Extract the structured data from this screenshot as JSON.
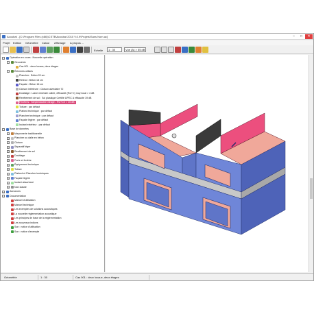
{
  "titlebar": {
    "title": "Acoubat - [C:\\Program Files (x86)\\CSTB\\Acoubat 2010 V.0.9\\Projets\\Sans Nom.ac]",
    "minimize": "–",
    "maximize": "□",
    "close": "✕"
  },
  "menubar": {
    "items": [
      "Projet",
      "Edition",
      "Géométrie",
      "Calcul",
      "Affichage",
      "A propos ..."
    ]
  },
  "toolbar": {
    "scale_label": "Echelle",
    "scale_value": "1 : 30",
    "result_value": "Vue (A) > 55 dB"
  },
  "tree": {
    "rows": [
      {
        "label": "Opération en cours : Nouvelle opération",
        "level": 0,
        "toggle": "-",
        "icon_color": "#3a6fc4"
      },
      {
        "label": "Géométrie",
        "level": 1,
        "toggle": "-",
        "icon_color": "#5a8a3a"
      },
      {
        "label": "Cas 001 : deux locaux, deux étages",
        "level": 2,
        "toggle": "",
        "icon_color": "#e0b040"
      },
      {
        "label": "Éléments utilisés",
        "level": 1,
        "toggle": "-",
        "icon_color": "#5a8a3a"
      },
      {
        "label": "Plancher : Béton 20 cm",
        "level": 2,
        "toggle": "",
        "icon_color": "#c0c0c0"
      },
      {
        "label": "Refend : Béton 18 cm",
        "level": 2,
        "toggle": "",
        "icon_color": "#404040"
      },
      {
        "label": "Façade : Béton 16 cm",
        "level": 2,
        "toggle": "",
        "icon_color": "#5a5acc"
      },
      {
        "label": "Cloison intérieure : Cloison alvéolaire 72",
        "level": 2,
        "toggle": "",
        "icon_color": "#b0b0b0"
      },
      {
        "label": "Doublage : Laine minérale collée, efficacité (Rw+C) moy local > 4 dB",
        "level": 2,
        "toggle": "",
        "icon_color": "#c04040"
      },
      {
        "label": "Revêtement de sol : Sol plastique Certifié UPEC A efficacité 19 dB",
        "level": 2,
        "toggle": "",
        "icon_color": "#8a5a30"
      },
      {
        "label": "Fenêtres : Simple/double vitrage - Rw+Ctr = 35 dB",
        "level": 2,
        "toggle": "",
        "icon_color": "#e06090",
        "highlight": true
      },
      {
        "label": "Toiture : par défaut",
        "level": 2,
        "toggle": "",
        "icon_color": "#e0e040"
      },
      {
        "label": "Plafond technique : par défaut",
        "level": 2,
        "toggle": "",
        "icon_color": "#80c0e0"
      },
      {
        "label": "Plancher technique : par défaut",
        "level": 2,
        "toggle": "",
        "icon_color": "#a0a0d0"
      },
      {
        "label": "Façade légère : par défaut",
        "level": 2,
        "toggle": "",
        "icon_color": "#6080d0"
      },
      {
        "label": "Isolant extérieur : par défaut",
        "level": 2,
        "toggle": "",
        "icon_color": "#a0e0a0"
      },
      {
        "label": "Base de données",
        "level": 0,
        "toggle": "-",
        "icon_color": "#3a6fc4"
      },
      {
        "label": "Maçonnerie traditionnelle",
        "level": 1,
        "toggle": "+",
        "icon_color": "#c08040"
      },
      {
        "label": "Plancher ou dalle en béton",
        "level": 1,
        "toggle": "+",
        "icon_color": "#c0c0c0"
      },
      {
        "label": "Cloison",
        "level": 1,
        "toggle": "+",
        "icon_color": "#b0b0b0"
      },
      {
        "label": "Séparatif léger",
        "level": 1,
        "toggle": "+",
        "icon_color": "#9090c0"
      },
      {
        "label": "Revêtement de sol",
        "level": 1,
        "toggle": "+",
        "icon_color": "#8a5a30"
      },
      {
        "label": "Doublage",
        "level": 1,
        "toggle": "+",
        "icon_color": "#c04040"
      },
      {
        "label": "Porte et fenêtre",
        "level": 1,
        "toggle": "+",
        "icon_color": "#e06090"
      },
      {
        "label": "Équipement technique",
        "level": 1,
        "toggle": "+",
        "icon_color": "#60a060"
      },
      {
        "label": "Toiture",
        "level": 1,
        "toggle": "+",
        "icon_color": "#e0e040"
      },
      {
        "label": "Plafond et Plancher techniques",
        "level": 1,
        "toggle": "+",
        "icon_color": "#80c0e0"
      },
      {
        "label": "Façade légère",
        "level": 1,
        "toggle": "+",
        "icon_color": "#6080d0"
      },
      {
        "label": "Isolant absorbant",
        "level": 1,
        "toggle": "+",
        "icon_color": "#a0e0a0"
      },
      {
        "label": "Non classé",
        "level": 1,
        "toggle": "+",
        "icon_color": "#909090"
      },
      {
        "label": "Annonces",
        "level": 0,
        "toggle": "+",
        "icon_color": "#3a6fc4"
      },
      {
        "label": "Documentation",
        "level": 0,
        "toggle": "-",
        "icon_color": "#3a6fc4"
      },
      {
        "label": "Manuel d'utilisation",
        "level": 1,
        "toggle": "",
        "icon_color": "#d04040"
      },
      {
        "label": "Manuel technique",
        "level": 1,
        "toggle": "",
        "icon_color": "#d04040"
      },
      {
        "label": "Les exemples de solutions acoustiques",
        "level": 1,
        "toggle": "",
        "icon_color": "#d04040"
      },
      {
        "label": "La nouvelle réglementation acoustique",
        "level": 1,
        "toggle": "",
        "icon_color": "#d04040"
      },
      {
        "label": "Les principes de base de la réglementation",
        "level": 1,
        "toggle": "",
        "icon_color": "#d04040"
      },
      {
        "label": "Les nouveaux indices",
        "level": 1,
        "toggle": "",
        "icon_color": "#d04040"
      },
      {
        "label": "Son : notice d'utilisation",
        "level": 1,
        "toggle": "",
        "icon_color": "#40a040"
      },
      {
        "label": "Son : notice d'exemple",
        "level": 1,
        "toggle": "",
        "icon_color": "#40a040"
      }
    ]
  },
  "statusbar": {
    "mode": "Géométrie",
    "scale": "1 : 30",
    "case": "Cas 001 : deux locaux, deux étages"
  },
  "colors": {
    "facade": "#6f86d8",
    "facade_dark": "#4e63b8",
    "wall_pink": "#ec4f7e",
    "floor_salmon": "#f0a89a",
    "refend_dark": "#3a3a3a",
    "selection": "#d94a7a"
  }
}
